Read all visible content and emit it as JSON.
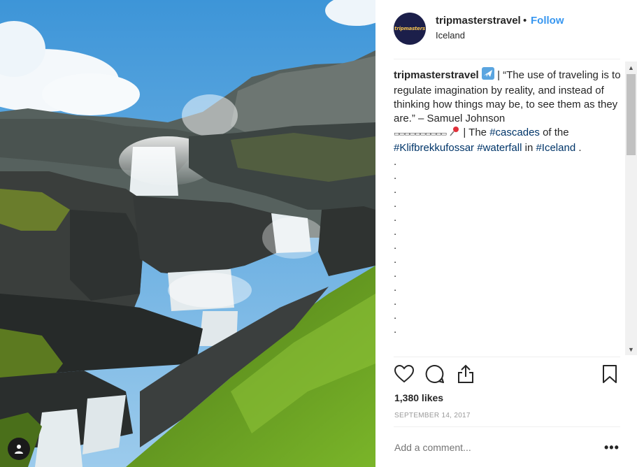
{
  "post": {
    "username": "tripmasterstravel",
    "follow_label": "Follow",
    "separator": "•",
    "location": "Iceland",
    "avatar_text": "tripmasters"
  },
  "caption": {
    "username": "tripmasterstravel",
    "airplane_emoji": "✈️",
    "quote": " | “The use of traveling is to regulate imagination by reality, and instead of thinking how things may be, to see them as they are.” – Samuel Johnson",
    "divider": "▭▭▭▭▭▭▭▭▭▭",
    "pin_emoji": "📌",
    "text_a": " | The ",
    "tag_cascades": "#cascades",
    "text_b": " of the ",
    "tag_place": "#Klifbrekkufossar",
    "text_c": " ",
    "tag_waterfall": "#waterfall",
    "text_d": " in ",
    "tag_iceland": "#Iceland",
    "text_e": " .",
    "dot_lines": [
      ".",
      ".",
      ".",
      ".",
      ".",
      ".",
      ".",
      ".",
      ".",
      ".",
      ".",
      ".",
      "."
    ]
  },
  "actions": {
    "like_icon": "heart-icon",
    "comment_icon": "comment-icon",
    "share_icon": "share-icon",
    "save_icon": "bookmark-icon"
  },
  "likes": "1,380 likes",
  "date": "SEPTEMBER 14, 2017",
  "comment_box": {
    "placeholder": "Add a comment..."
  },
  "more_label": "•••",
  "colors": {
    "link": "#3897f0",
    "hashtag": "#003569",
    "muted": "#999999"
  }
}
